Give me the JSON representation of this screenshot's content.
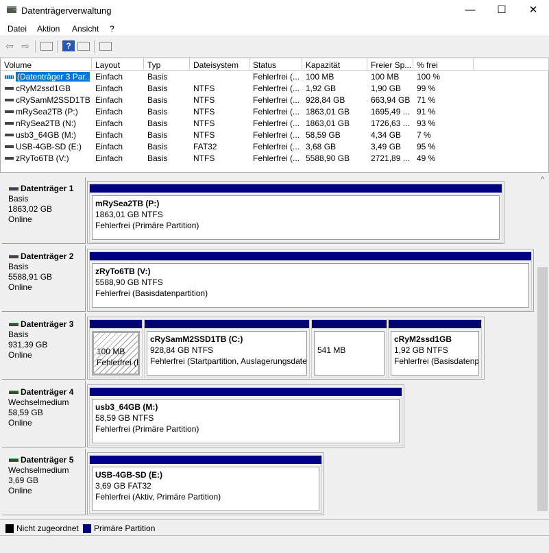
{
  "window": {
    "title": "Datenträgerverwaltung",
    "minimize": "—",
    "maximize": "☐",
    "close": "✕"
  },
  "menu": [
    "Datei",
    "Aktion",
    "Ansicht",
    "?"
  ],
  "toolbar": {
    "icons": [
      "back-arrow-icon",
      "forward-arrow-icon",
      "console-tree-icon",
      "help-icon",
      "action-pane-icon",
      "properties-icon"
    ]
  },
  "volume_list": {
    "columns": [
      "Volume",
      "Layout",
      "Typ",
      "Dateisystem",
      "Status",
      "Kapazität",
      "Freier Sp...",
      "% frei"
    ],
    "rows": [
      [
        "(Datenträger 3 Par...",
        "Einfach",
        "Basis",
        "",
        "Fehlerfrei (...",
        "100 MB",
        "100 MB",
        "100 %"
      ],
      [
        "cRyM2ssd1GB",
        "Einfach",
        "Basis",
        "NTFS",
        "Fehlerfrei (...",
        "1,92 GB",
        "1,90 GB",
        "99 %"
      ],
      [
        "cRySamM2SSD1TB...",
        "Einfach",
        "Basis",
        "NTFS",
        "Fehlerfrei (...",
        "928,84 GB",
        "663,94 GB",
        "71 %"
      ],
      [
        "mRySea2TB (P:)",
        "Einfach",
        "Basis",
        "NTFS",
        "Fehlerfrei (...",
        "1863,01 GB",
        "1695,49 ...",
        "91 %"
      ],
      [
        "nRySea2TB (N:)",
        "Einfach",
        "Basis",
        "NTFS",
        "Fehlerfrei (...",
        "1863,01 GB",
        "1726,63 ...",
        "93 %"
      ],
      [
        "usb3_64GB (M:)",
        "Einfach",
        "Basis",
        "NTFS",
        "Fehlerfrei (...",
        "58,59 GB",
        "4,34 GB",
        "7 %"
      ],
      [
        "USB-4GB-SD (E:)",
        "Einfach",
        "Basis",
        "FAT32",
        "Fehlerfrei (...",
        "3,68 GB",
        "3,49 GB",
        "95 %"
      ],
      [
        "zRyTo6TB (V:)",
        "Einfach",
        "Basis",
        "NTFS",
        "Fehlerfrei (...",
        "5588,90 GB",
        "2721,89 ...",
        "49 %"
      ]
    ]
  },
  "disks": [
    {
      "name": "Datenträger 1",
      "type": "Basis",
      "size": "1863,02 GB",
      "state": "Online",
      "partitions": [
        {
          "name": "mRySea2TB  (P:)",
          "size": "1863,01 GB NTFS",
          "status": "Fehlerfrei (Primäre Partition)"
        }
      ]
    },
    {
      "name": "Datenträger 2",
      "type": "Basis",
      "size": "5588,91 GB",
      "state": "Online",
      "partitions": [
        {
          "name": "zRyTo6TB  (V:)",
          "size": "5588,90 GB NTFS",
          "status": "Fehlerfrei (Basisdatenpartition)"
        }
      ]
    },
    {
      "name": "Datenträger 3",
      "type": "Basis",
      "size": "931,39 GB",
      "state": "Online",
      "partitions": [
        {
          "name": "",
          "size": "100 MB",
          "status": "Fehlerfrei (EFI-Systempartition)",
          "selected": true
        },
        {
          "name": "cRySamM2SSD1TB  (C:)",
          "size": "928,84 GB NTFS",
          "status": "Fehlerfrei (Startpartition, Auslagerungsdatei"
        },
        {
          "name": "",
          "size": "541 MB",
          "status": ""
        },
        {
          "name": "cRyM2ssd1GB",
          "size": "1,92 GB NTFS",
          "status": "Fehlerfrei (Basisdatenpartition)"
        }
      ]
    },
    {
      "name": "Datenträger 4",
      "type": "Wechselmedium",
      "size": "58,59 GB",
      "state": "Online",
      "partitions": [
        {
          "name": "usb3_64GB  (M:)",
          "size": "58,59 GB NTFS",
          "status": "Fehlerfrei (Primäre Partition)"
        }
      ]
    },
    {
      "name": "Datenträger 5",
      "type": "Wechselmedium",
      "size": "3,69 GB",
      "state": "Online",
      "partitions": [
        {
          "name": "USB-4GB-SD  (E:)",
          "size": "3,69 GB FAT32",
          "status": "Fehlerfrei (Aktiv, Primäre Partition)"
        }
      ]
    }
  ],
  "legend": [
    {
      "label": "Nicht zugeordnet",
      "color": "#000000"
    },
    {
      "label": "Primäre Partition",
      "color": "#000080"
    }
  ]
}
